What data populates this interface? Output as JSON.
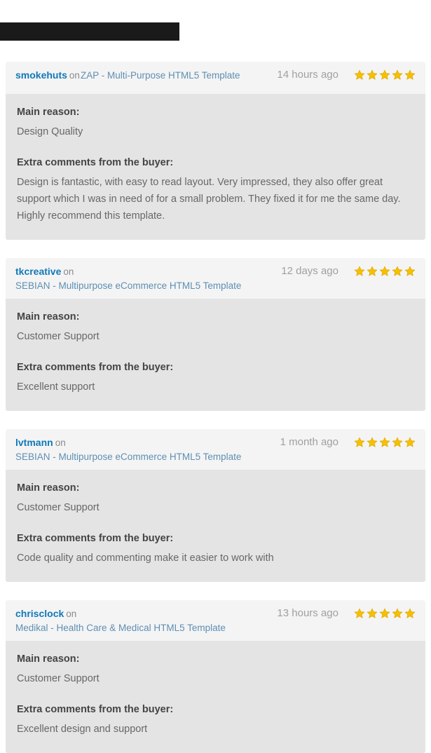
{
  "page": {
    "title": "Recent Reviews",
    "title_redacted": true,
    "visible_title_fragment": "s",
    "colors": {
      "author_blue": "#1079b8",
      "link_blue": "#5e8fb3",
      "timestamp_gray": "#a0a0a0",
      "label_gray": "#444444",
      "value_gray": "#676767",
      "head_bg": "#f4f4f4",
      "body_bg": "#e4e4e4",
      "star_gold": "#f5c000",
      "page_bg": "#ffffff"
    }
  },
  "labels": {
    "on": "on",
    "main_reason": "Main reason:",
    "extra_comments": "Extra comments from the buyer:",
    "star_icon": "star-icon"
  },
  "reviews": [
    {
      "author": "smokehuts",
      "item": "ZAP - Multi-Purpose HTML5 Template",
      "timeago": "14 hours ago",
      "rating": 5,
      "main_reason": "Design Quality",
      "comment": "Design is fantastic, with easy to read layout. Very impressed, they also offer great support which I was in need of for a small problem. They fixed it for me the same day. Highly recommend this template.",
      "wrap_item": false
    },
    {
      "author": "tkcreative",
      "item": "SEBIAN - Multipurpose eCommerce HTML5 Template",
      "timeago": "12 days ago",
      "rating": 5,
      "main_reason": "Customer Support",
      "comment": "Excellent support",
      "wrap_item": true
    },
    {
      "author": "lvtmann",
      "item": "SEBIAN - Multipurpose eCommerce HTML5 Template",
      "timeago": "1 month ago",
      "rating": 5,
      "main_reason": "Customer Support",
      "comment": "Code quality and commenting make it easier to work with",
      "wrap_item": true
    },
    {
      "author": "chrisclock",
      "item": "Medikal - Health Care & Medical HTML5 Template",
      "timeago": "13 hours ago",
      "rating": 5,
      "main_reason": "Customer Support",
      "comment": "Excellent design and support",
      "wrap_item": true
    }
  ]
}
